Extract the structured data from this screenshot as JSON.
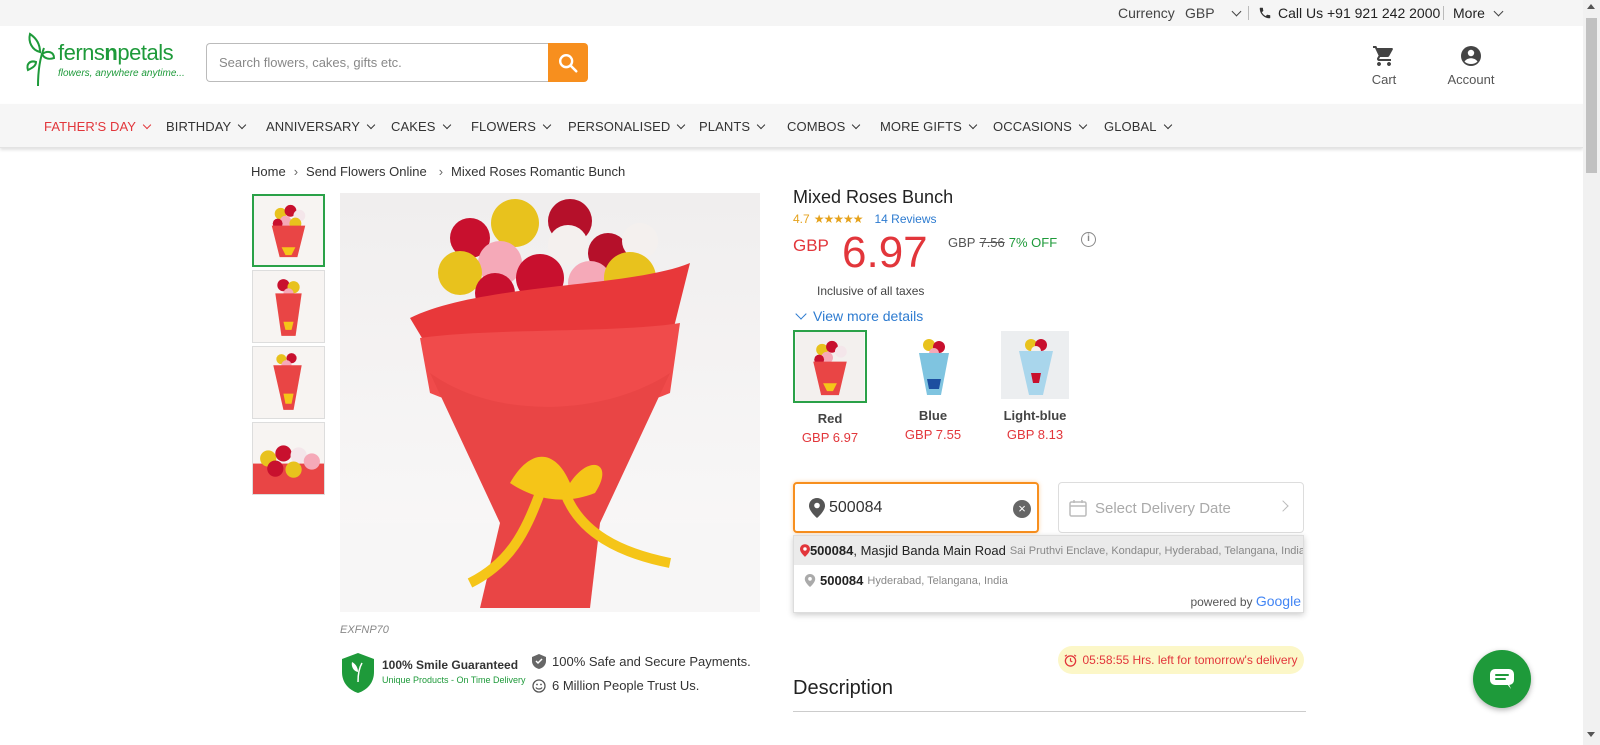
{
  "topbar": {
    "currency_label": "Currency",
    "currency_value": "GBP",
    "call_label": "Call Us +91 921 242 2000",
    "more_label": "More"
  },
  "header": {
    "logo_name_part1": "ferns",
    "logo_name_part2": "n",
    "logo_name_part3": "petals",
    "logo_tagline": "flowers, anywhere anytime...",
    "search_placeholder": "Search flowers, cakes, gifts etc.",
    "cart_label": "Cart",
    "account_label": "Account"
  },
  "nav": {
    "items": [
      {
        "label": "FATHER'S DAY"
      },
      {
        "label": "BIRTHDAY"
      },
      {
        "label": "ANNIVERSARY"
      },
      {
        "label": "CAKES"
      },
      {
        "label": "FLOWERS"
      },
      {
        "label": "PERSONALISED"
      },
      {
        "label": "PLANTS"
      },
      {
        "label": "COMBOS"
      },
      {
        "label": "MORE GIFTS"
      },
      {
        "label": "OCCASIONS"
      },
      {
        "label": "GLOBAL"
      }
    ]
  },
  "breadcrumb": {
    "home": "Home",
    "level1": "Send Flowers Online",
    "current": "Mixed Roses Romantic Bunch"
  },
  "product": {
    "sku": "EXFNP70",
    "title": "Mixed Roses Bunch",
    "rating_value": "4.7",
    "stars": "★★★★★",
    "reviews": "14 Reviews",
    "currency": "GBP",
    "price": "6.97",
    "old_currency": "GBP",
    "old_price": "7.56",
    "discount": "7% OFF",
    "taxes_note": "Inclusive of all taxes",
    "view_more": "View more details",
    "variants": [
      {
        "name": "Red",
        "price": "GBP  6.97"
      },
      {
        "name": "Blue",
        "price": "GBP  7.55"
      },
      {
        "name": "Light-blue",
        "price": "GBP  8.13"
      }
    ]
  },
  "trust": {
    "smile_title": "100% Smile Guaranteed",
    "smile_sub": "Unique Products - On Time Delivery",
    "payments": "100% Safe and Secure Payments.",
    "people": "6 Million People Trust Us."
  },
  "delivery": {
    "pincode_value": "500084",
    "date_placeholder": "Select Delivery Date",
    "suggestions": [
      {
        "code": "500084",
        "main": ", Masjid Banda Main Road",
        "secondary": "Sai Pruthvi Enclave, Kondapur, Hyderabad, Telangana, India"
      },
      {
        "code": "500084",
        "main": "",
        "secondary": "Hyderabad, Telangana, India"
      }
    ],
    "powered_by": "powered by",
    "google": "Google",
    "timer_text": "05:58:55 Hrs. left for tomorrow's delivery"
  },
  "description_heading": "Description",
  "colors": {
    "brand_green": "#1e9a3a",
    "accent_orange": "#f78f1e",
    "price_red": "#e2363b",
    "link_blue": "#2d7bd0"
  }
}
